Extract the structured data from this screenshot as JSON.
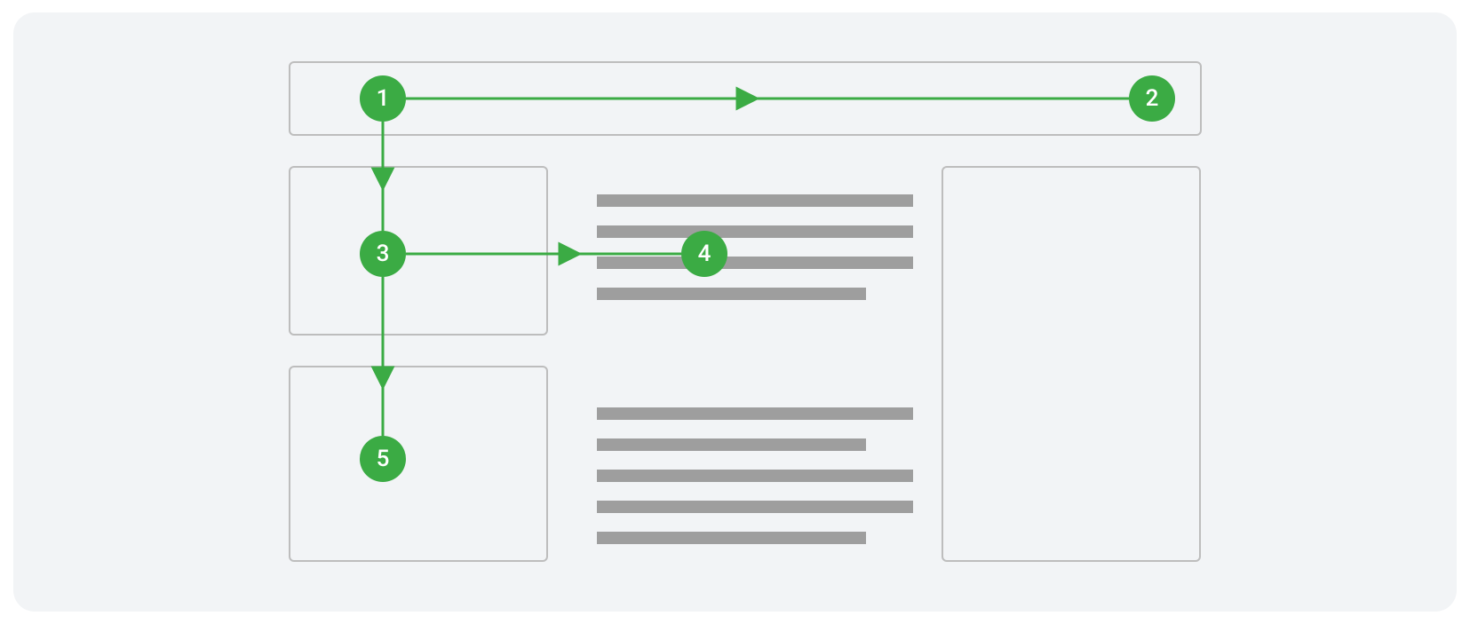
{
  "diagram": {
    "description": "Focus / reading-order traversal diagram over a page wireframe layout",
    "accent_color": "#3bab44",
    "neutral_stroke": "#bdbdbd",
    "placeholder_fill": "#9e9e9e",
    "markers": [
      {
        "id": "m1",
        "label": "1",
        "region": "header-start"
      },
      {
        "id": "m2",
        "label": "2",
        "region": "header-end"
      },
      {
        "id": "m3",
        "label": "3",
        "region": "left-card-top"
      },
      {
        "id": "m4",
        "label": "4",
        "region": "content-paragraph-1"
      },
      {
        "id": "m5",
        "label": "5",
        "region": "left-card-bottom"
      }
    ],
    "arrows": [
      {
        "from": "1",
        "to": "2",
        "dir": "right"
      },
      {
        "from": "1",
        "to": "3",
        "dir": "down"
      },
      {
        "from": "3",
        "to": "4",
        "dir": "right"
      },
      {
        "from": "3",
        "to": "5",
        "dir": "down"
      }
    ],
    "regions": [
      {
        "name": "header",
        "role": "app-bar"
      },
      {
        "name": "card-a",
        "role": "left-column-block"
      },
      {
        "name": "card-b",
        "role": "left-column-block"
      },
      {
        "name": "content",
        "role": "main-text"
      },
      {
        "name": "sidebar",
        "role": "right-rail"
      }
    ]
  }
}
